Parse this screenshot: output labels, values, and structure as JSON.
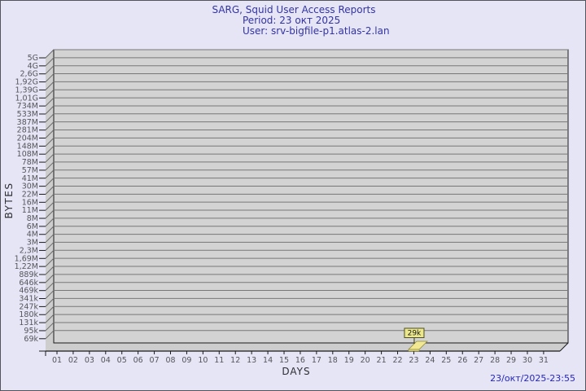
{
  "page": {
    "background_color": "#e5e5f6",
    "border_color": "#54545c"
  },
  "header": {
    "title": "SARG, Squid User Access Reports",
    "period": "Period: 23 окт 2025",
    "user": "User: srv-bigfile-p1.atlas-2.lan",
    "text_color": "#3434a4"
  },
  "footer": {
    "timestamp": "23/окт/2025-23:55",
    "text_color": "#2626bb"
  },
  "chart_data": {
    "type": "bar",
    "title": "SARG, Squid User Access Reports",
    "xlabel": "DAYS",
    "ylabel": "BYTES",
    "scale": "logarithmic",
    "categories": [
      "01",
      "02",
      "03",
      "04",
      "05",
      "06",
      "07",
      "08",
      "09",
      "10",
      "11",
      "12",
      "13",
      "14",
      "15",
      "16",
      "17",
      "18",
      "19",
      "20",
      "21",
      "22",
      "23",
      "24",
      "25",
      "26",
      "27",
      "28",
      "29",
      "30",
      "31"
    ],
    "values": [
      0,
      0,
      0,
      0,
      0,
      0,
      0,
      0,
      0,
      0,
      0,
      0,
      0,
      0,
      0,
      0,
      0,
      0,
      0,
      0,
      0,
      0,
      29000,
      0,
      0,
      0,
      0,
      0,
      0,
      0,
      0
    ],
    "y_tick_labels": [
      "5G",
      "4G",
      "2,6G",
      "1,92G",
      "1,39G",
      "1,01G",
      "734M",
      "533M",
      "387M",
      "281M",
      "204M",
      "148M",
      "108M",
      "78M",
      "57M",
      "41M",
      "30M",
      "22M",
      "16M",
      "11M",
      "8M",
      "6M",
      "4M",
      "3M",
      "2,3M",
      "1,69M",
      "1,22M",
      "889k",
      "646k",
      "469k",
      "341k",
      "247k",
      "180k",
      "131k",
      "95k",
      "69k"
    ],
    "ylim_labels": [
      "69k",
      "5G"
    ],
    "grid": true,
    "legend_position": "none",
    "bars": [
      {
        "day": "23",
        "value_label": "29k",
        "approx_bytes": 29000
      }
    ],
    "colors": {
      "wall_face": "#d3d3d3",
      "wall_side": "#cdcdcd",
      "grid_line": "#777777",
      "axis_line": "#1a1a1a",
      "tick_text": "#55555a",
      "axis_title_text": "#2e2e33",
      "bar_top": "#f2e792",
      "bar_front": "#e3d878",
      "bar_edge": "#8a8a3a",
      "annotation_fill": "#eae78c",
      "annotation_border": "#4f4f20",
      "annotation_text": "#161616"
    }
  }
}
